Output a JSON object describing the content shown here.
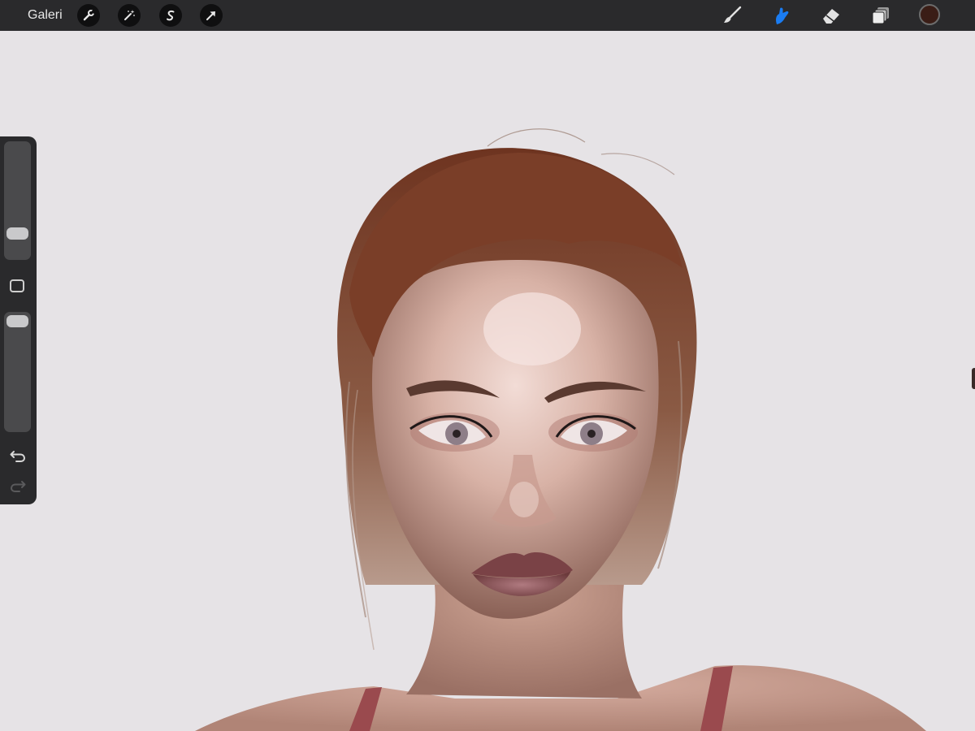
{
  "app": {
    "gallery_label": "Galeri",
    "accent_color": "#1a7cf2"
  },
  "toolbar_left": {
    "icons": [
      "wrench-icon",
      "magic-wand-icon",
      "selection-s-icon",
      "arrow-transform-icon"
    ]
  },
  "toolbar_right": {
    "tools": [
      "brush-icon",
      "smudge-icon",
      "eraser-icon",
      "layers-icon"
    ],
    "active_tool": "smudge-icon",
    "current_color": "#3a1d16"
  },
  "sidebar": {
    "size_slider_value": 0.82,
    "opacity_slider_value": 0.05,
    "controls": [
      "modify-button",
      "undo-icon",
      "redo-icon"
    ],
    "redo_enabled": false
  },
  "canvas": {
    "background_color": "#e6e3e6",
    "artwork": "portrait-painting"
  }
}
